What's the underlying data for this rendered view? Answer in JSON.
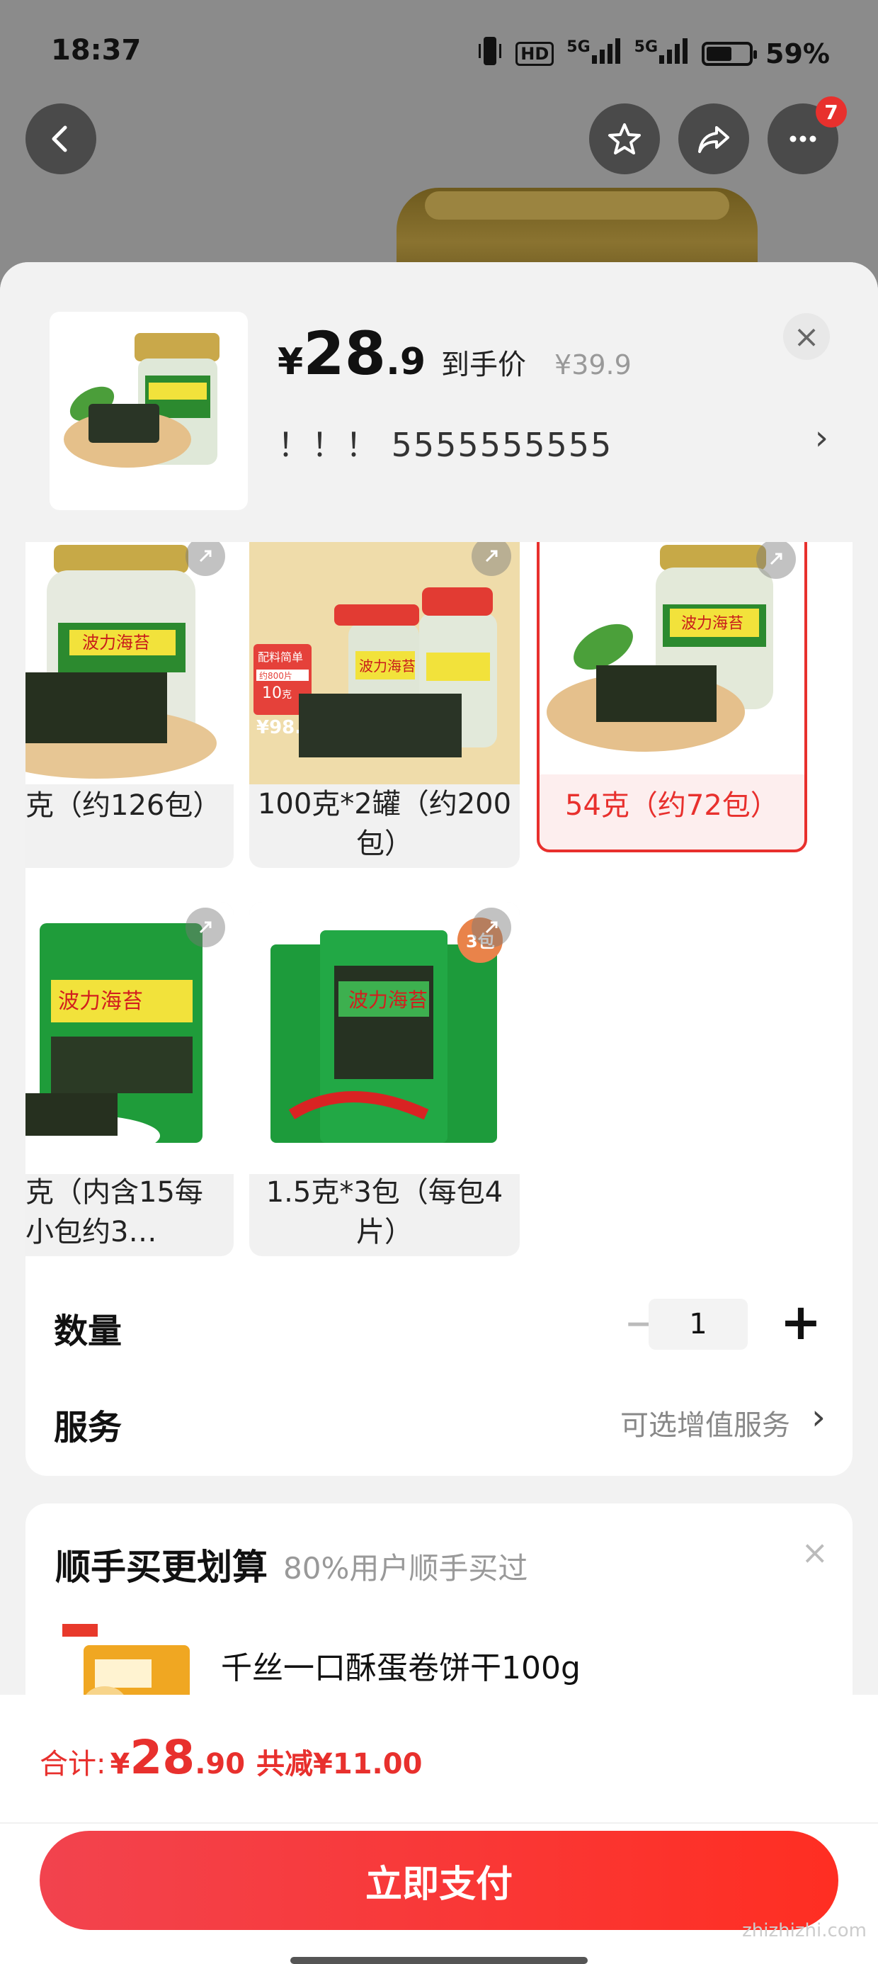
{
  "status_bar": {
    "time": "18:37",
    "hd": "HD",
    "signal1": "5G",
    "signal2": "5G",
    "battery_percent": "59%",
    "battery_level": 0.59
  },
  "nav": {
    "badge_count": "7"
  },
  "product": {
    "price_symbol": "¥",
    "price_integer": "28",
    "price_decimal": ".9",
    "price_label": "到手价",
    "original_price": "¥39.9",
    "variant_text": "！！！ 5555555555"
  },
  "options": [
    {
      "label": "克（约126包）",
      "package_text": "波力海苔",
      "selected": false
    },
    {
      "label": "100克*2罐（约200包）",
      "package_text": "波力海苔",
      "promo_title": "配料简单",
      "promo_sub": "约800片",
      "promo_price": "98.8",
      "promo_tag": "10",
      "promo_unit": "克",
      "selected": false
    },
    {
      "label": "54克（约72包）",
      "package_text": "波力海苔",
      "selected": true
    },
    {
      "label": "克（内含15每小包约3…",
      "package_text": "波力海苔",
      "selected": false
    },
    {
      "label": "1.5克*3包（每包4片）",
      "package_text": "波力海苔",
      "pack_badge": "3包",
      "selected": false
    }
  ],
  "quantity": {
    "label": "数量",
    "value": "1",
    "minus": "−",
    "plus": "+"
  },
  "service": {
    "label": "服务",
    "hint": "可选增值服务"
  },
  "addon": {
    "title": "顺手买更划算",
    "subtitle": "80%用户顺手买过",
    "item_name": "千丝一口酥蛋卷饼干100g"
  },
  "footer": {
    "total_label": "合计:",
    "total_symbol": "¥",
    "total_integer": "28",
    "total_decimal": ".90",
    "discount_text": "共减¥11.00",
    "pay_button": "立即支付",
    "watermark": "zhizhizhi.com"
  },
  "colors": {
    "accent": "#e8302d",
    "pay_gradient_start": "#f2434e",
    "pay_gradient_end": "#ff2e22"
  }
}
